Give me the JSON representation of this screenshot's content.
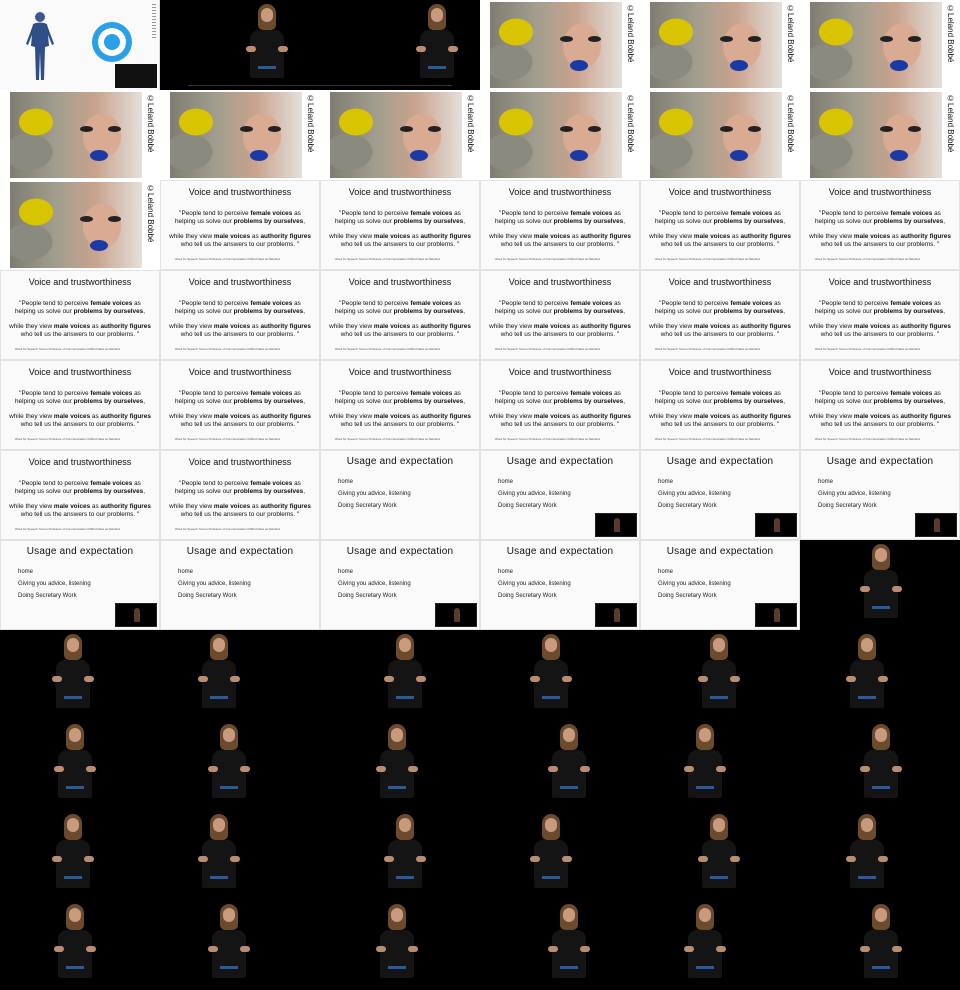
{
  "portrait_label": "©Leland Bobbé",
  "quote_slide": {
    "title": "Voice and trustworthiness",
    "line1_a": "\"People tend to perceive ",
    "line1_b": "female voices",
    "line1_c": " as",
    "line2_a": "helping us solve our ",
    "line2_b": "problems by ourselves",
    "line2_c": ",",
    "line3_a": "while they view ",
    "line3_b": "male voices",
    "line3_c": " as ",
    "line3_d": "authority figures",
    "line4": "who tell us the answers to our problems. \"",
    "source": "Word for Speech: former Professor of Communication Clifford Nass at Stanford"
  },
  "usage_slide": {
    "title": "Usage and expectation",
    "items": [
      "home",
      "Giving you advice, listening",
      "Doing Secretary Work"
    ]
  },
  "tiles": [
    {
      "type": "intro"
    },
    {
      "type": "wide"
    },
    {
      "type": "portrait"
    },
    {
      "type": "portrait"
    },
    {
      "type": "portrait"
    },
    {
      "type": "portrait"
    },
    {
      "type": "portrait"
    },
    {
      "type": "portrait"
    },
    {
      "type": "portrait"
    },
    {
      "type": "portrait"
    },
    {
      "type": "portrait"
    },
    {
      "type": "portrait"
    },
    {
      "type": "quote"
    },
    {
      "type": "quote"
    },
    {
      "type": "quote"
    },
    {
      "type": "quote"
    },
    {
      "type": "quote"
    },
    {
      "type": "quote"
    },
    {
      "type": "quote"
    },
    {
      "type": "quote"
    },
    {
      "type": "quote"
    },
    {
      "type": "quote"
    },
    {
      "type": "quote"
    },
    {
      "type": "quote"
    },
    {
      "type": "quote"
    },
    {
      "type": "quote"
    },
    {
      "type": "quote"
    },
    {
      "type": "quote"
    },
    {
      "type": "quote"
    },
    {
      "type": "quote"
    },
    {
      "type": "quote"
    },
    {
      "type": "usage",
      "pip": false
    },
    {
      "type": "usage",
      "pip": true
    },
    {
      "type": "usage",
      "pip": true
    },
    {
      "type": "usage",
      "pip": true
    },
    {
      "type": "usage",
      "pip": true
    },
    {
      "type": "usage",
      "pip": false
    },
    {
      "type": "usage",
      "pip": true
    },
    {
      "type": "usage",
      "pip": true
    },
    {
      "type": "usage",
      "pip": true
    },
    {
      "type": "speaker"
    },
    {
      "type": "speaker"
    },
    {
      "type": "speaker"
    },
    {
      "type": "speaker"
    },
    {
      "type": "speaker"
    },
    {
      "type": "speaker"
    },
    {
      "type": "speaker"
    },
    {
      "type": "speaker"
    },
    {
      "type": "speaker"
    },
    {
      "type": "speaker"
    },
    {
      "type": "speaker"
    },
    {
      "type": "speaker"
    },
    {
      "type": "speaker"
    },
    {
      "type": "speaker"
    },
    {
      "type": "speaker"
    },
    {
      "type": "speaker"
    },
    {
      "type": "speaker"
    },
    {
      "type": "speaker"
    },
    {
      "type": "speaker"
    },
    {
      "type": "speaker"
    },
    {
      "type": "speaker"
    },
    {
      "type": "speaker"
    },
    {
      "type": "speaker"
    },
    {
      "type": "speaker"
    },
    {
      "type": "speaker"
    }
  ],
  "colors": {
    "slide_bg": "#fafafa",
    "accent_ring": "#2aa0e8",
    "lip_blue": "#1b3aa6",
    "hair_yellow": "#d8c400"
  }
}
